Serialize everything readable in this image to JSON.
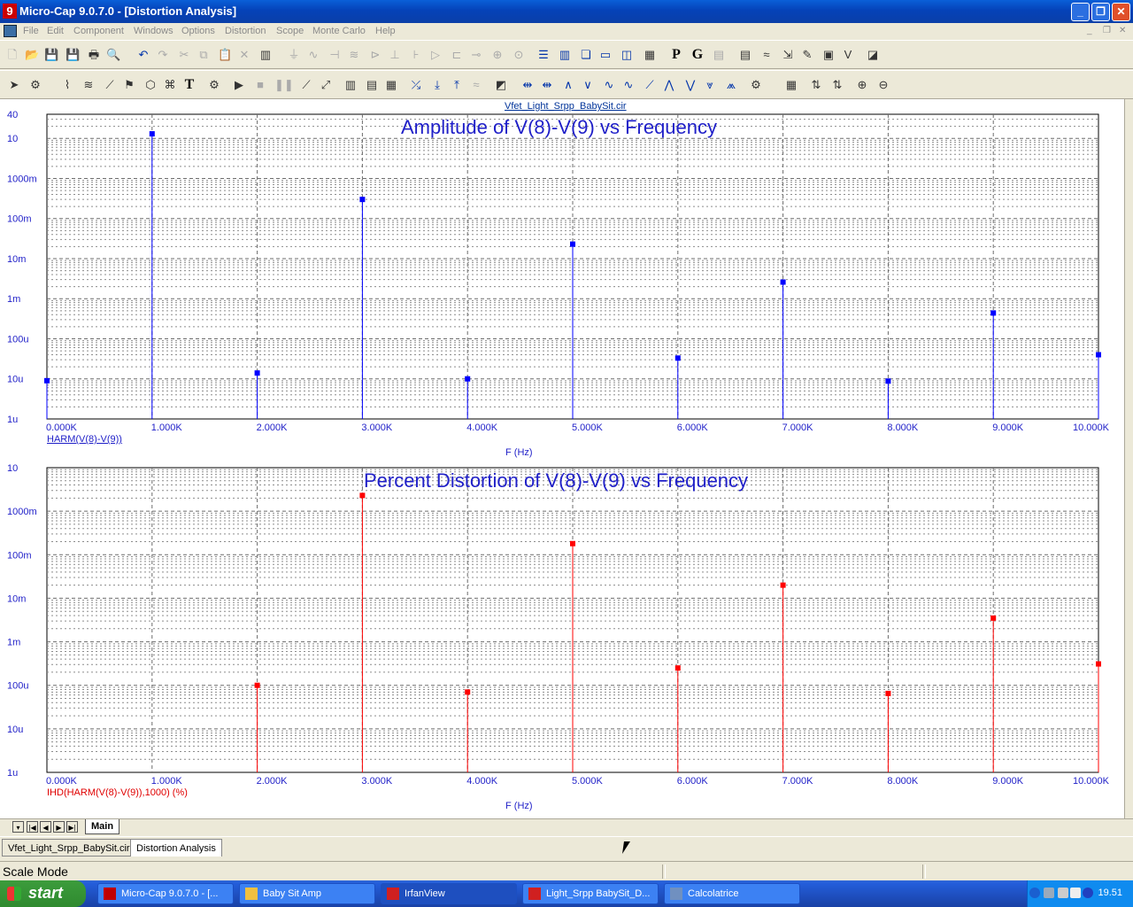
{
  "window": {
    "title": "Micro-Cap 9.0.7.0 - [Distortion Analysis]",
    "app_icon": "9",
    "minimize_icon": "minimize-icon",
    "maximize_icon": "restore-icon",
    "close_icon": "close-icon"
  },
  "menubar": {
    "items": [
      "File",
      "Edit",
      "Component",
      "Windows",
      "Options",
      "Distortion",
      "Scope",
      "Monte Carlo",
      "Help"
    ]
  },
  "plot": {
    "circuit_name": "Vfet_Light_Srpp_BabySit.cir",
    "x_ticks": [
      "0.000K",
      "1.000K",
      "2.000K",
      "3.000K",
      "4.000K",
      "5.000K",
      "6.000K",
      "7.000K",
      "8.000K",
      "9.000K",
      "10.000K"
    ],
    "x_axis_label": "F (Hz)",
    "amplitude": {
      "title": "Amplitude of V(8)-V(9) vs Frequency",
      "expression": "HARM(V(8)-V(9))",
      "y_ticks": [
        "40",
        "10",
        "1000m",
        "100m",
        "10m",
        "1m",
        "100u",
        "10u",
        "1u"
      ],
      "color": "#0000ff"
    },
    "distortion": {
      "title": "Percent Distortion of V(8)-V(9) vs Frequency",
      "expression": "IHD(HARM(V(8)-V(9)),1000) (%)",
      "y_ticks": [
        "10",
        "1000m",
        "100m",
        "10m",
        "1m",
        "100u",
        "10u",
        "1u"
      ],
      "color": "#ff0000"
    }
  },
  "chart_data": [
    {
      "type": "bar",
      "title": "Amplitude of V(8)-V(9) vs Frequency",
      "xlabel": "F (Hz)",
      "ylabel": "HARM(V(8)-V(9))",
      "x_scale": "linear",
      "y_scale": "log",
      "xlim": [
        0,
        10000
      ],
      "ylim": [
        1e-06,
        40
      ],
      "grid": true,
      "series": [
        {
          "name": "HARM(V(8)-V(9))",
          "x": [
            0,
            1000,
            2000,
            3000,
            4000,
            5000,
            6000,
            7000,
            8000,
            9000,
            10000
          ],
          "values": [
            9e-06,
            13,
            1.4e-05,
            0.3,
            1e-05,
            0.023,
            3.3e-05,
            0.0026,
            8.8e-06,
            0.00044,
            4e-05
          ]
        }
      ]
    },
    {
      "type": "bar",
      "title": "Percent Distortion of V(8)-V(9) vs Frequency",
      "xlabel": "F (Hz)",
      "ylabel": "IHD(HARM(V(8)-V(9)),1000) (%)",
      "x_scale": "linear",
      "y_scale": "log",
      "xlim": [
        0,
        10000
      ],
      "ylim": [
        1e-06,
        10
      ],
      "grid": true,
      "series": [
        {
          "name": "IHD(HARM(V(8)-V(9)),1000) (%)",
          "x": [
            2000,
            3000,
            4000,
            5000,
            6000,
            7000,
            8000,
            9000,
            10000
          ],
          "values": [
            0.0001,
            2.3,
            7e-05,
            0.18,
            0.00025,
            0.02,
            6.5e-05,
            0.0035,
            0.00031
          ]
        }
      ]
    }
  ],
  "sheet_tabs": {
    "active": "Main"
  },
  "doc_tabs": [
    "Vfet_Light_Srpp_BabySit.cir",
    "Distortion Analysis"
  ],
  "status": {
    "text": "Scale Mode"
  },
  "taskbar": {
    "start_label": "start",
    "buttons": [
      {
        "label": "Micro-Cap 9.0.7.0 - [...",
        "color": "#c00000"
      },
      {
        "label": "Baby Sit Amp",
        "color": "#f0c040"
      },
      {
        "label": "IrfanView",
        "color": "#d02020"
      },
      {
        "label": "Light_Srpp BabySit_D...",
        "color": "#d02020"
      },
      {
        "label": "Calcolatrice",
        "color": "#7090c0"
      }
    ],
    "clock": "19.51"
  }
}
